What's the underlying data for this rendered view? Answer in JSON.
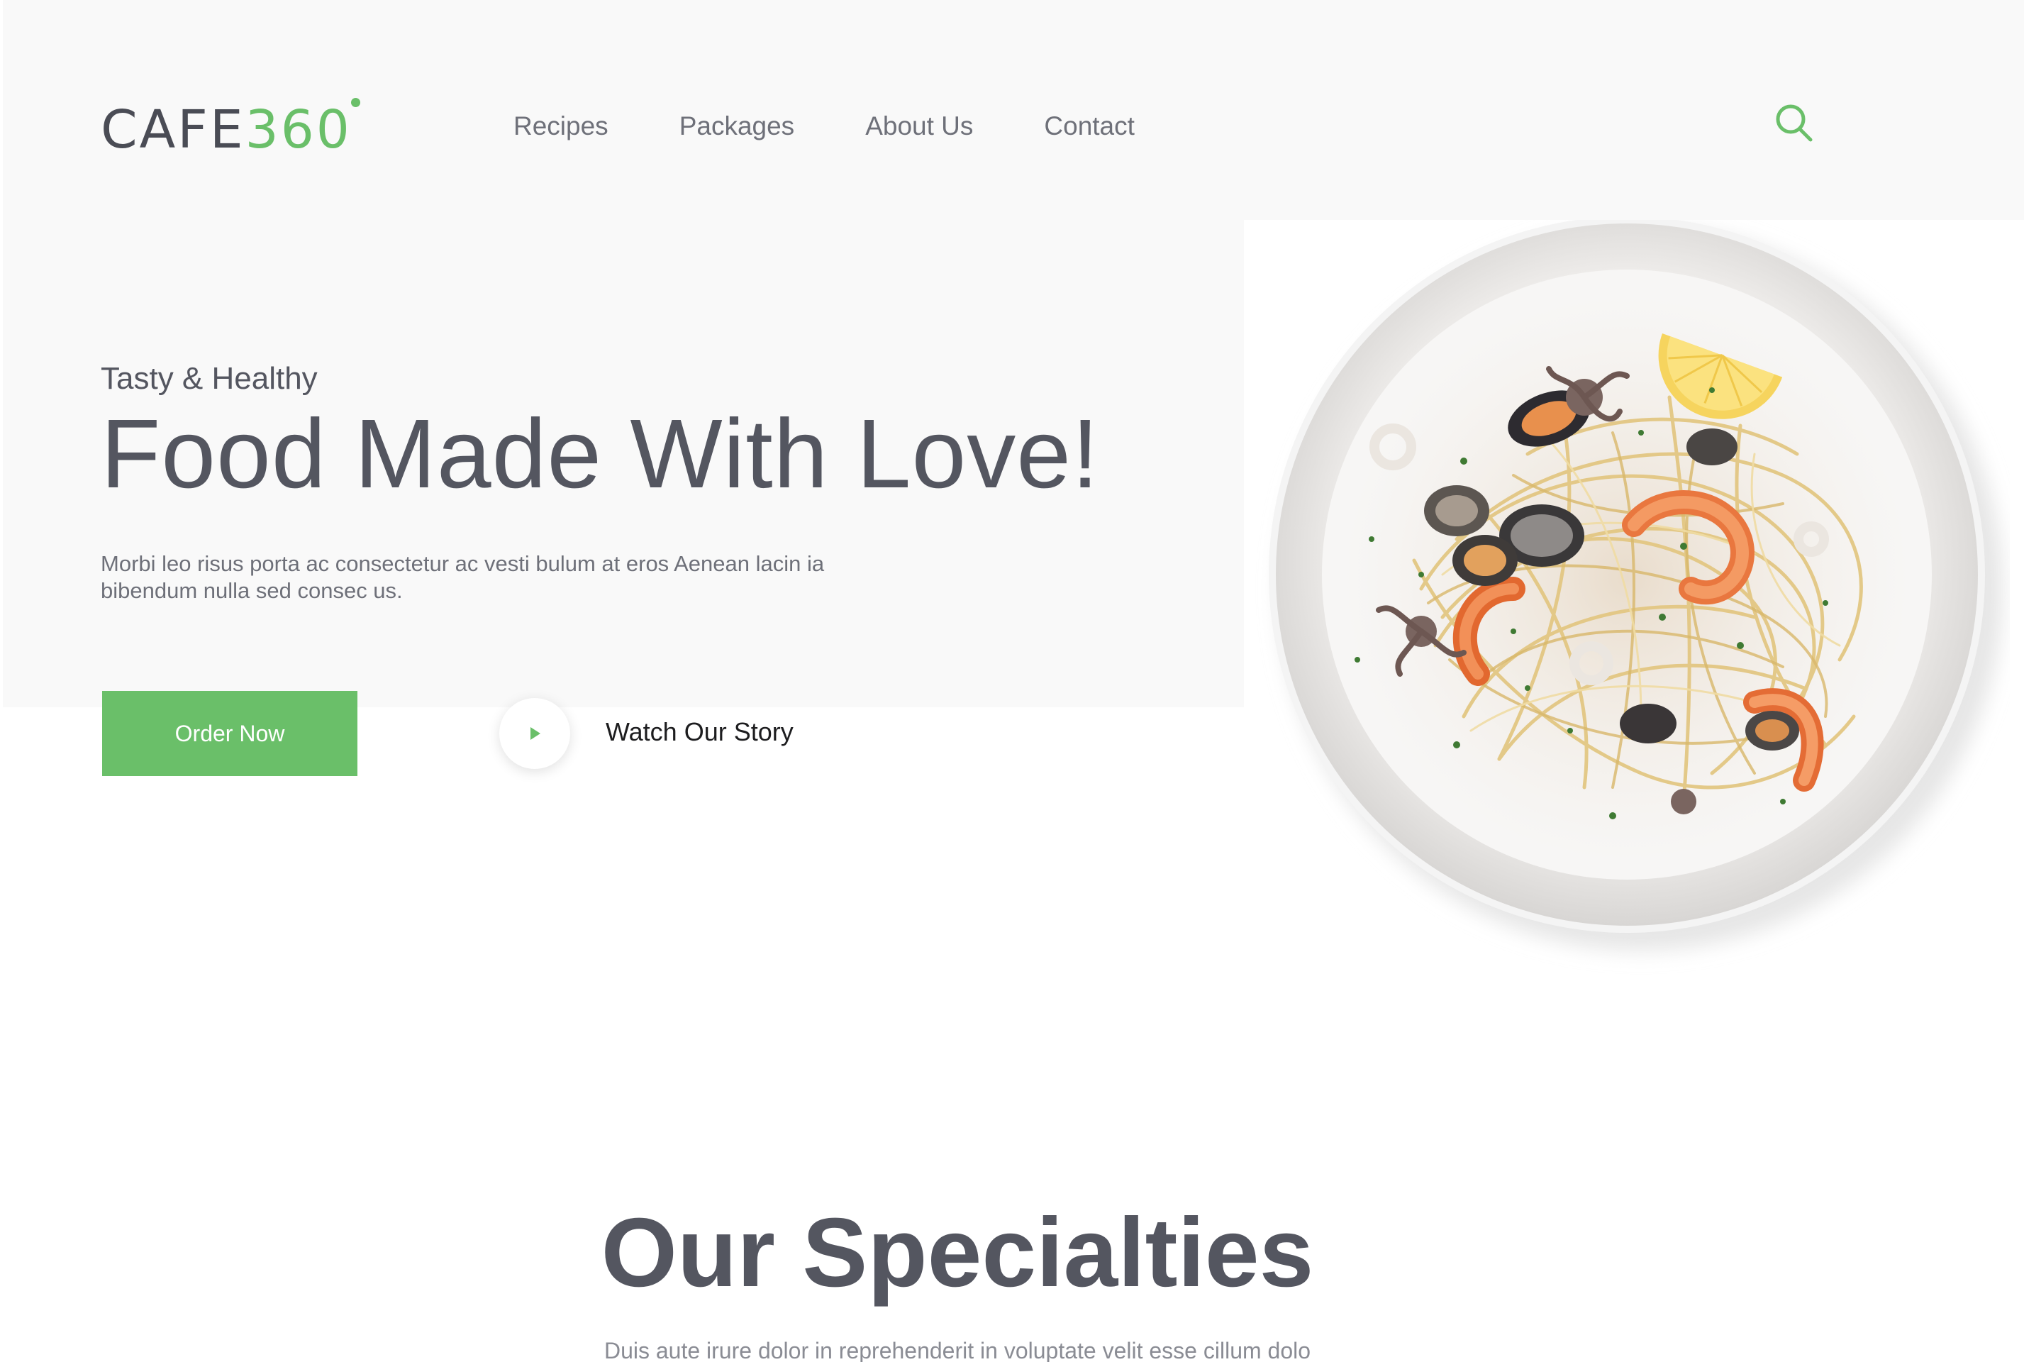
{
  "brand": {
    "logo_main": "CAFE",
    "logo_accent": "360",
    "accent_color": "#6abf69",
    "text_color": "#545660"
  },
  "nav": {
    "items": [
      {
        "label": "Recipes"
      },
      {
        "label": "Packages"
      },
      {
        "label": "About Us"
      },
      {
        "label": "Contact"
      }
    ],
    "search_icon": "search-icon"
  },
  "hero": {
    "eyebrow": "Tasty & Healthy",
    "headline": "Food Made With Love!",
    "body": "Morbi leo risus porta ac consectetur ac vesti bulum at eros Aenean lacin ia bibendum nulla sed consec us.",
    "order_button": "Order Now",
    "play_icon": "play-icon",
    "watch_label": "Watch Our Story",
    "image": "plate-of-seafood-spaghetti"
  },
  "specialties": {
    "title": "Our Specialties",
    "subtitle": "Duis aute irure dolor in reprehenderit in voluptate velit esse cillum dolo"
  }
}
